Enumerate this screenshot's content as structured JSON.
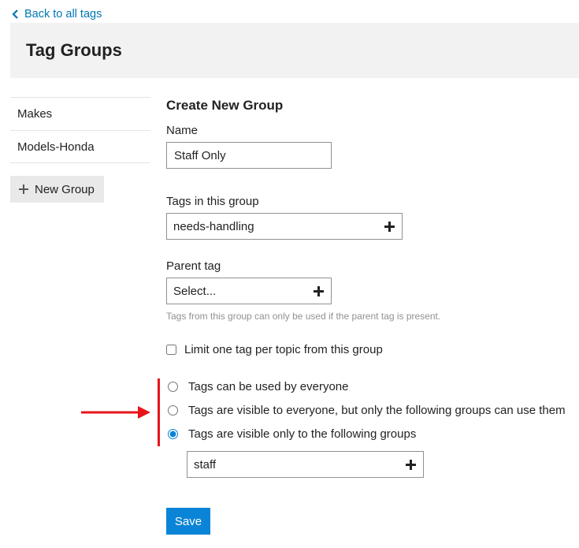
{
  "nav": {
    "back_label": "Back to all tags"
  },
  "header": {
    "title": "Tag Groups"
  },
  "sidebar": {
    "items": [
      {
        "label": "Makes"
      },
      {
        "label": "Models-Honda"
      }
    ],
    "new_group_label": "New Group"
  },
  "form": {
    "title": "Create New Group",
    "name_label": "Name",
    "name_value": "Staff Only",
    "tags_label": "Tags in this group",
    "tags_value": "needs-handling",
    "parent_label": "Parent tag",
    "parent_placeholder": "Select...",
    "parent_help": "Tags from this group can only be used if the parent tag is present.",
    "limit_label": "Limit one tag per topic from this group",
    "limit_checked": false,
    "visibility_options": [
      {
        "label": "Tags can be used by everyone",
        "selected": false
      },
      {
        "label": "Tags are visible to everyone, but only the following groups can use them",
        "selected": false
      },
      {
        "label": "Tags are visible only to the following groups",
        "selected": true
      }
    ],
    "groups_value": "staff",
    "save_label": "Save"
  },
  "colors": {
    "link": "#0077b3",
    "primary_button": "#0a84d6",
    "annotation": "#e8141b",
    "header_bg": "#f2f2f2"
  },
  "icons": {
    "back": "chevron-left-icon",
    "add": "plus-icon"
  }
}
